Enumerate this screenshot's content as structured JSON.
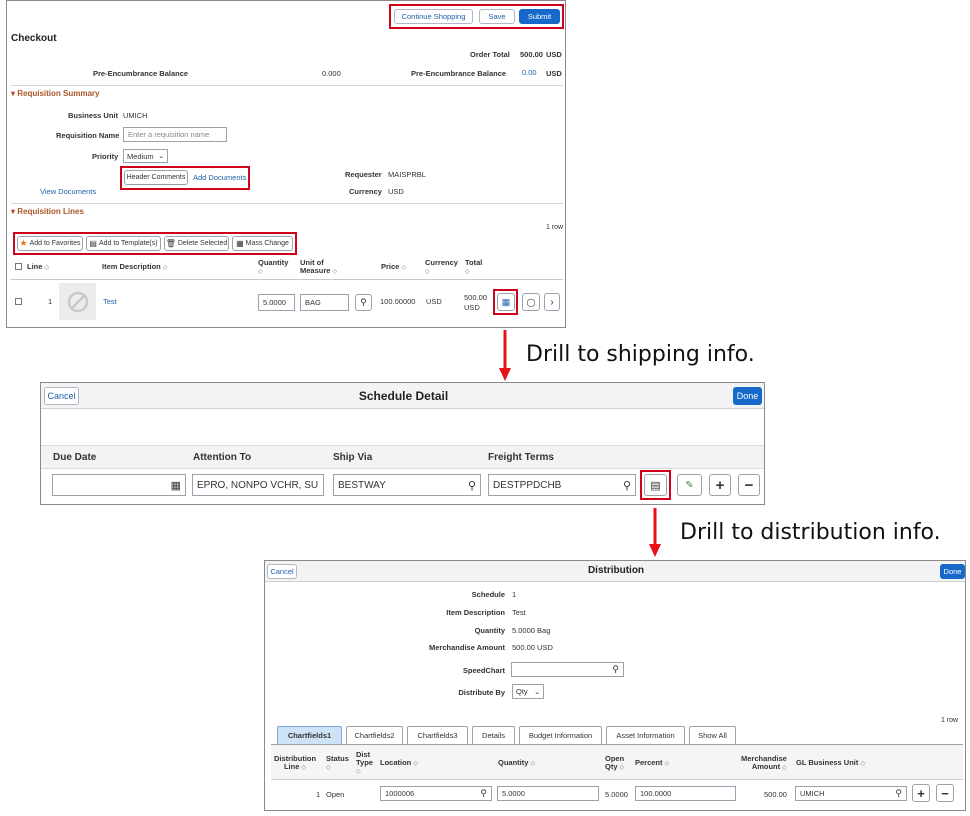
{
  "checkout": {
    "buttons": {
      "continue": "Continue Shopping",
      "save": "Save",
      "submit": "Submit"
    },
    "title": "Checkout",
    "order_total_label": "Order Total",
    "order_total_value": "500.00",
    "order_total_currency": "USD",
    "pre_enc_left_label": "Pre-Encumbrance Balance",
    "pre_enc_left_value": "0.000",
    "pre_enc_right_label": "Pre-Encumbrance Balance",
    "pre_enc_right_value": "0.00",
    "pre_enc_right_currency": "USD",
    "req_summary_title": "Requisition Summary",
    "business_unit_label": "Business Unit",
    "business_unit_value": "UMICH",
    "req_name_label": "Requisition Name",
    "req_name_placeholder": "Enter a requisition name",
    "priority_label": "Priority",
    "priority_value": "Medium",
    "header_comments": "Header Comments",
    "add_documents": "Add Documents",
    "view_documents": "View Documents",
    "requester_label": "Requester",
    "requester_value": "MAISPRBL",
    "currency_label": "Currency",
    "currency_value": "USD",
    "req_lines_title": "Requisition Lines",
    "row_count": "1 row",
    "toolbar": {
      "favorites": "Add to Favorites",
      "template": "Add to Template(s)",
      "delete": "Delete Selected",
      "mass_change": "Mass Change"
    },
    "columns": {
      "line": "Line",
      "item_desc": "Item Description",
      "quantity": "Quantity",
      "uom_1": "Unit of",
      "uom_2": "Measure",
      "price": "Price",
      "currency": "Currency",
      "total": "Total"
    },
    "row": {
      "line": "1",
      "item": "Test",
      "quantity": "5.0000",
      "uom": "BAG",
      "price": "100.00000",
      "currency": "USD",
      "total_1": "500.00",
      "total_2": "USD"
    }
  },
  "caption_shipping": "Drill to shipping info.",
  "schedule": {
    "cancel": "Cancel",
    "title": "Schedule Detail",
    "done": "Done",
    "columns": {
      "due_date": "Due Date",
      "attention": "Attention To",
      "ship_via": "Ship Via",
      "freight": "Freight Terms"
    },
    "row": {
      "attention": "EPRO, NONPO VCHR, SU",
      "ship_via": "BESTWAY",
      "freight": "DESTPPDCHB"
    }
  },
  "caption_distribution": "Drill to distribution info.",
  "distribution": {
    "cancel": "Cancel",
    "title": "Distribution",
    "done": "Done",
    "schedule_label": "Schedule",
    "schedule_value": "1",
    "item_desc_label": "Item Description",
    "item_desc_value": "Test",
    "quantity_label": "Quantity",
    "quantity_value": "5.0000",
    "quantity_unit": "Bag",
    "merch_label": "Merchandise Amount",
    "merch_value": "500.00",
    "merch_currency": "USD",
    "speedchart_label": "SpeedChart",
    "distribute_by_label": "Distribute By",
    "distribute_by_value": "Qty",
    "row_count": "1 row",
    "tabs": [
      "Chartfields1",
      "Chartfields2",
      "Chartfields3",
      "Details",
      "Budget Information",
      "Asset Information",
      "Show All"
    ],
    "columns": {
      "dist_line_1": "Distribution",
      "dist_line_2": "Line",
      "status": "Status",
      "dist_type_1": "Dist",
      "dist_type_2": "Type",
      "location": "Location",
      "quantity": "Quantity",
      "open_qty_1": "Open",
      "open_qty_2": "Qty",
      "percent": "Percent",
      "merch_1": "Merchandise",
      "merch_2": "Amount",
      "gl_bu": "GL Business Unit"
    },
    "row": {
      "line": "1",
      "status": "Open",
      "location": "1000006",
      "quantity": "5.0000",
      "open_qty": "5.0000",
      "percent": "100.0000",
      "merch": "500.00",
      "gl_bu": "UMICH"
    }
  },
  "colors": {
    "link": "#1f5fa8",
    "primary": "#1668c9",
    "section": "#a8542a",
    "highlight": "#d0021b"
  }
}
